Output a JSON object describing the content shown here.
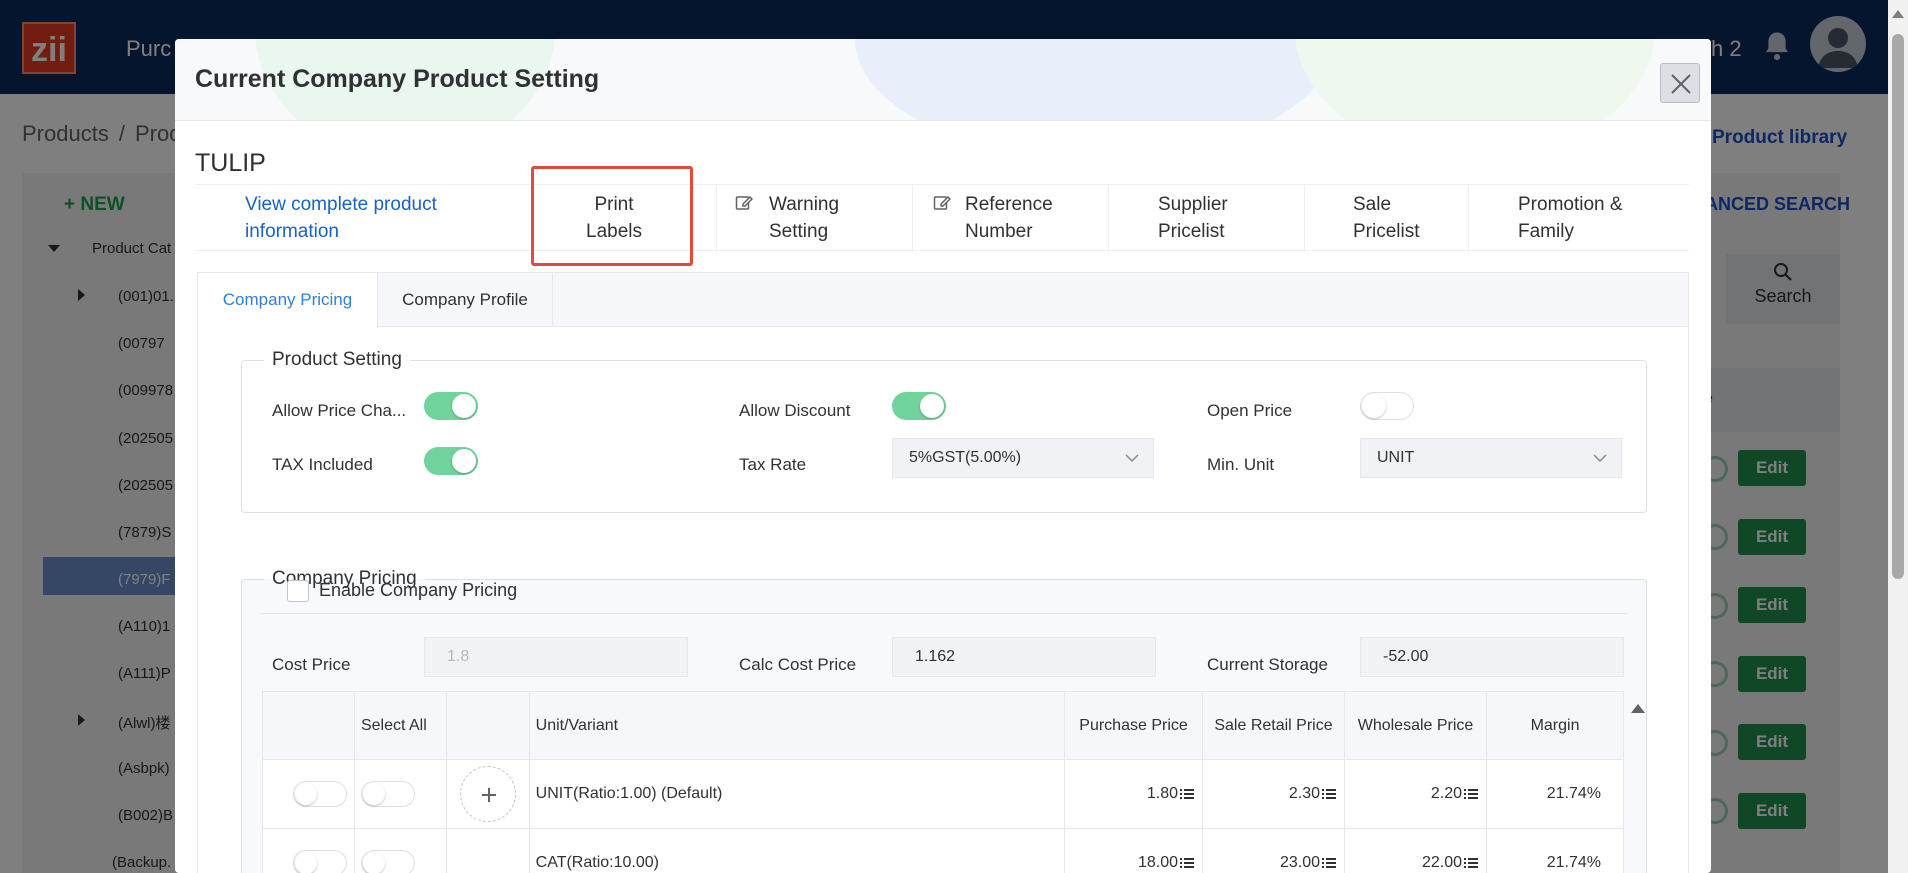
{
  "app": {
    "logo_text": "zii",
    "nav_partial": "Purc",
    "branch_partial": "ch 2",
    "breadcrumb": [
      "Products",
      "Prod"
    ],
    "product_library_link": "Product library",
    "new_button": "NEW",
    "advanced_search_partial": "ANCED SEARCH",
    "search_button": "Search",
    "tree_root": "Product Cat",
    "tree_items": [
      "(001)01.",
      "(00797",
      "(009978",
      "(202505",
      "(202505",
      "(7879)S",
      "(7979)F",
      "(A110)1",
      "(A111)P",
      "(Alwl)楼",
      "(Asbpk)",
      "(B002)B",
      "(Backup."
    ],
    "column_partial": "e",
    "edit_label": "Edit"
  },
  "modal": {
    "title": "Current Company Product Setting",
    "product_name": "TULIP",
    "actions": {
      "view_info": "View complete product information",
      "print_labels": "Print Labels",
      "warning_setting": "Warning Setting",
      "reference_number": "Reference Number",
      "supplier_pricelist": "Supplier Pricelist",
      "sale_pricelist": "Sale Pricelist",
      "promotion_family": "Promotion & Family"
    },
    "tabs": [
      "Company Pricing",
      "Company Profile"
    ],
    "product_setting": {
      "legend": "Product Setting",
      "allow_price_change": {
        "label": "Allow Price Cha...",
        "on": true
      },
      "allow_discount": {
        "label": "Allow Discount",
        "on": true
      },
      "open_price": {
        "label": "Open Price",
        "on": false
      },
      "tax_included": {
        "label": "TAX Included",
        "on": true
      },
      "tax_rate": {
        "label": "Tax Rate",
        "value": "5%GST(5.00%)"
      },
      "min_unit": {
        "label": "Min. Unit",
        "value": "UNIT"
      }
    },
    "company_pricing": {
      "legend": "Company Pricing",
      "enable_label": "Enable Company Pricing",
      "cost_price": {
        "label": "Cost Price",
        "value": "1.8"
      },
      "calc_cost_price": {
        "label": "Calc Cost Price",
        "value": "1.162"
      },
      "current_storage": {
        "label": "Current Storage",
        "value": "-52.00"
      }
    },
    "table": {
      "headers": [
        "",
        "Select All",
        "",
        "Unit/Variant",
        "Purchase Price",
        "Sale Retail Price",
        "Wholesale Price",
        "Margin"
      ],
      "rows": [
        {
          "unit": "UNIT(Ratio:1.00) (Default)",
          "purchase": "1.80",
          "retail": "2.30",
          "wholesale": "2.20",
          "margin": "21.74%"
        },
        {
          "unit": "CAT(Ratio:10.00)",
          "purchase": "18.00",
          "retail": "23.00",
          "wholesale": "22.00",
          "margin": "21.74%"
        }
      ]
    }
  }
}
